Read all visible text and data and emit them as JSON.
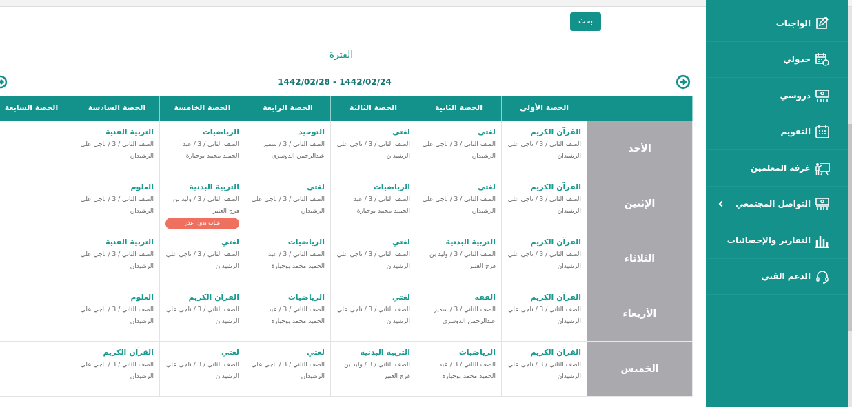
{
  "search_button": "بحث",
  "period_title": "الفترة",
  "date_range": "1442/02/24 - 1442/02/28",
  "table": {
    "columns": [
      "الحصة الأولى",
      "الحصة الثانية",
      "الحصة الثالثة",
      "الحصة الرابعة",
      "الحصة الخامسة",
      "الحصة السادسة",
      "الحصة السابعة"
    ],
    "rows": [
      {
        "day": "الأحد",
        "cells": [
          {
            "subject": "القرآن الكريم",
            "detail": "الصف الثاني / 3 / ناجي علي الرشيدان"
          },
          {
            "subject": "لغتي",
            "detail": "الصف الثاني / 3 / ناجي علي الرشيدان"
          },
          {
            "subject": "لغتي",
            "detail": "الصف الثاني / 3 / ناجي علي الرشيدان"
          },
          {
            "subject": "التوحيد",
            "detail": "الصف الثاني / 3 / سمير عبدالرحمن الدوسري"
          },
          {
            "subject": "الرياضيات",
            "detail": "الصف الثاني / 3 / عبد الحميد محمد بوجبارة"
          },
          {
            "subject": "التربية الفنية",
            "detail": "الصف الثاني / 3 / ناجي علي الرشيدان"
          }
        ]
      },
      {
        "day": "الإثنين",
        "cells": [
          {
            "subject": "القرآن الكريم",
            "detail": "الصف الثاني / 3 / ناجي علي الرشيدان"
          },
          {
            "subject": "لغتي",
            "detail": "الصف الثاني / 3 / ناجي علي الرشيدان"
          },
          {
            "subject": "الرياضيات",
            "detail": "الصف الثاني / 3 / عبد الحميد محمد بوجبارة"
          },
          {
            "subject": "لغتي",
            "detail": "الصف الثاني / 3 / ناجي علي الرشيدان"
          },
          {
            "subject": "التربية البدنية",
            "detail": "الصف الثاني / 3 / وليد بن فرج العنبر",
            "badge": "غياب بدون عذر"
          },
          {
            "subject": "العلوم",
            "detail": "الصف الثاني / 3 / ناجي علي الرشيدان"
          }
        ]
      },
      {
        "day": "الثلاثاء",
        "cells": [
          {
            "subject": "القرآن الكريم",
            "detail": "الصف الثاني / 3 / ناجي علي الرشيدان"
          },
          {
            "subject": "التربية البدنية",
            "detail": "الصف الثاني / 3 / وليد بن فرج العنبر"
          },
          {
            "subject": "لغتي",
            "detail": "الصف الثاني / 3 / ناجي علي الرشيدان"
          },
          {
            "subject": "الرياضيات",
            "detail": "الصف الثاني / 3 / عبد الحميد محمد بوجبارة"
          },
          {
            "subject": "لغتي",
            "detail": "الصف الثاني / 3 / ناجي علي الرشيدان"
          },
          {
            "subject": "التربية الفنية",
            "detail": "الصف الثاني / 3 / ناجي علي الرشيدان"
          }
        ]
      },
      {
        "day": "الأربعاء",
        "cells": [
          {
            "subject": "القرآن الكريم",
            "detail": "الصف الثاني / 3 / ناجي علي الرشيدان"
          },
          {
            "subject": "الفقه",
            "detail": "الصف الثاني / 3 / سمير عبدالرحمن الدوسري"
          },
          {
            "subject": "لغتي",
            "detail": "الصف الثاني / 3 / ناجي علي الرشيدان"
          },
          {
            "subject": "الرياضيات",
            "detail": "الصف الثاني / 3 / عبد الحميد محمد بوجبارة"
          },
          {
            "subject": "القرآن الكريم",
            "detail": "الصف الثاني / 3 / ناجي علي الرشيدان"
          },
          {
            "subject": "العلوم",
            "detail": "الصف الثاني / 3 / ناجي علي الرشيدان"
          }
        ]
      },
      {
        "day": "الخميس",
        "cells": [
          {
            "subject": "القرآن الكريم",
            "detail": "الصف الثاني / 3 / ناجي علي الرشيدان"
          },
          {
            "subject": "الرياضيات",
            "detail": "الصف الثاني / 3 / عبد الحميد محمد بوجبارة"
          },
          {
            "subject": "التربية البدنية",
            "detail": "الصف الثاني / 3 / وليد بن فرج العنبر"
          },
          {
            "subject": "لغتي",
            "detail": "الصف الثاني / 3 / ناجي علي الرشيدان"
          },
          {
            "subject": "لغتي",
            "detail": "الصف الثاني / 3 / ناجي علي الرشيدان"
          },
          {
            "subject": "القرآن الكريم",
            "detail": "الصف الثاني / 3 / ناجي علي الرشيدان"
          }
        ]
      }
    ]
  },
  "sidebar": {
    "items": [
      {
        "label": "الواجبات",
        "kind": "homework",
        "submenu": false
      },
      {
        "label": "جدولي",
        "kind": "schedule",
        "submenu": false
      },
      {
        "label": "دروسي",
        "kind": "lessons",
        "submenu": false
      },
      {
        "label": "التقويم",
        "kind": "calendar",
        "submenu": false
      },
      {
        "label": "غرفة المعلمين",
        "kind": "teacher",
        "submenu": false
      },
      {
        "label": "التواصل المجتمعي",
        "kind": "lessons",
        "submenu": true
      },
      {
        "label": "التقارير والإحصائيات",
        "kind": "chart",
        "submenu": false
      },
      {
        "label": "الدعم الفني",
        "kind": "support",
        "submenu": false
      }
    ]
  }
}
